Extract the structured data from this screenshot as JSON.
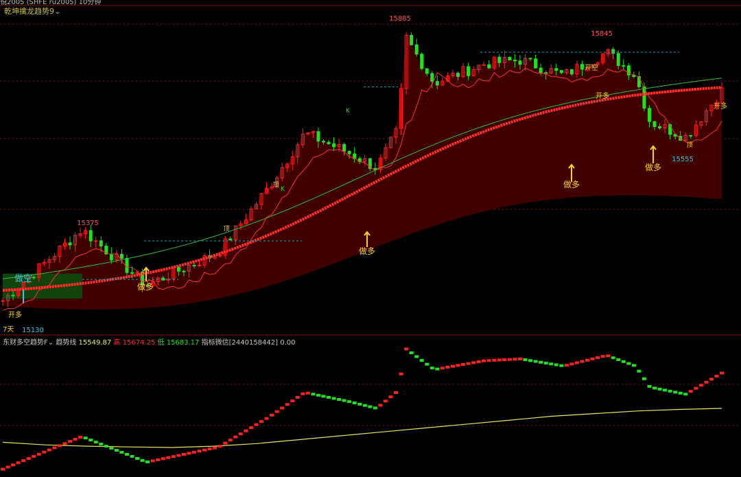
{
  "header": {
    "instrument": "锐2005 (SHFE ru2005) 10分钟",
    "main_indicator": "乾坤擒龙趋势9"
  },
  "sub_panel": {
    "name": "东财多空趋势F",
    "trend_label": "趋势线",
    "trend_value": "15549.87",
    "high_label": "高",
    "high_value": "15674.25",
    "low_label": "低",
    "low_value": "15683.17",
    "signal_label": "指标微信[2440158442]",
    "signal_value": "0.00"
  },
  "colors": {
    "up": "#ff2020",
    "down": "#20e020",
    "background": "#000000",
    "trend_fill": "#4a0000",
    "trend_line": "#ff3030",
    "signal_text": "#ffd020",
    "ma_line": "#e8e860",
    "grid": "#8a1010"
  },
  "chart_data": [
    {
      "type": "candlestick",
      "title": "乾坤擒龙趋势9",
      "price_labels": [
        {
          "text": "15885",
          "value": 15885
        },
        {
          "text": "15845",
          "value": 15845
        },
        {
          "text": "15375",
          "value": 15375
        },
        {
          "text": "15130",
          "value": 15130
        },
        {
          "text": "15555",
          "value": 15555
        }
      ],
      "annotations": [
        "做空",
        "开多",
        "做多",
        "做多",
        "做多",
        "做多",
        "开空",
        "开多",
        "开多",
        "顶",
        "顶",
        "顶",
        "K",
        "K"
      ],
      "bottom_left_label": "7天",
      "y_range": [
        15100,
        15920
      ]
    },
    {
      "type": "line",
      "title": "东财多空趋势F",
      "series": [
        {
          "name": "趋势线",
          "values": [
            15420,
            15410,
            15405,
            15402,
            15400,
            15405,
            15415,
            15430,
            15445,
            15460,
            15475,
            15490,
            15505,
            15520,
            15530,
            15540,
            15546,
            15549.87
          ]
        }
      ]
    }
  ]
}
